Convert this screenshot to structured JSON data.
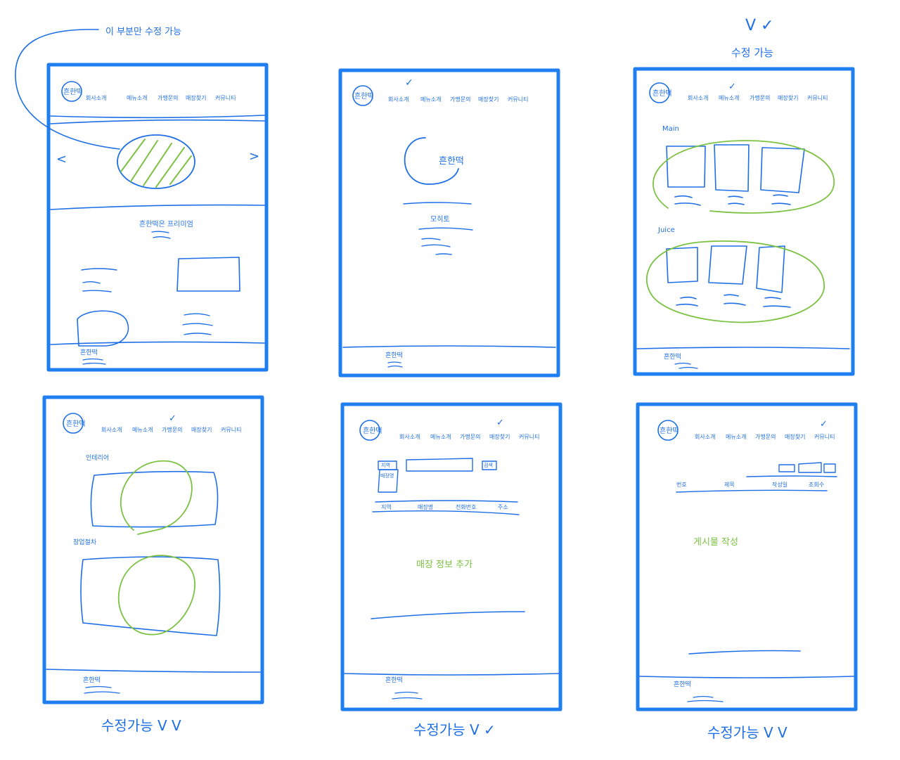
{
  "colors": {
    "ink": "#1e6fe6",
    "frame": "#1f7ff0",
    "accent": "#7cc242",
    "background": "#ffffff"
  },
  "annotation_top": "이 부분만 수정 가능",
  "nav": {
    "logo": "흔한떡",
    "items": [
      "회사소개",
      "메뉴소개",
      "가맹문의",
      "매장찾기",
      "커뮤니티"
    ]
  },
  "frames": [
    {
      "id": "home",
      "slider_prev": "<",
      "slider_next": ">",
      "section_title": "흔한떡은 프리미엄",
      "footer_logo": "흔한떡"
    },
    {
      "id": "about",
      "hero_logo": "흔한떡",
      "section_title": "모히토",
      "footer_logo": "흔한떡",
      "check": "✓"
    },
    {
      "id": "menu",
      "label_main": "Main",
      "label_juice": "Juice",
      "footer_logo": "흔한떡",
      "check": "✓",
      "note_above": "수정 가능",
      "note_marks": "V ✓"
    },
    {
      "id": "franchise",
      "label_interior": "인테리어",
      "label_process": "창업절차",
      "footer_logo": "흔한떡",
      "check": "✓",
      "note_below": "수정가능 V V"
    },
    {
      "id": "stores",
      "filter_region": "지역",
      "filter_store": "매장명",
      "search_button": "검색",
      "table_headers": [
        "지역",
        "매장명",
        "전화번호",
        "주소"
      ],
      "add_note": "매장 정보 추가",
      "footer_logo": "흔한떡",
      "check": "✓",
      "note_below": "수정가능 V ✓"
    },
    {
      "id": "community",
      "table_headers": [
        "번호",
        "제목",
        "작성일",
        "조회수"
      ],
      "write_note": "게시물 작성",
      "footer_logo": "흔한떡",
      "check": "✓",
      "note_below": "수정가능 V V"
    }
  ]
}
